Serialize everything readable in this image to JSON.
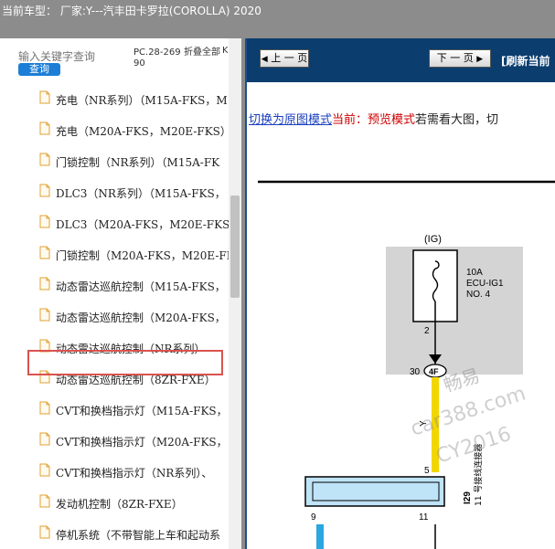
{
  "window": {
    "title": "当前车型：  厂家:Y---汽丰田卡罗拉(COROLLA) 2020"
  },
  "sidebar": {
    "search_placeholder": "输入关键字查询",
    "search_button": "查询",
    "pc_code": "PC.28-26990",
    "collapse_all": "折叠全部",
    "cut_text": "K",
    "items": [
      {
        "label": "充电（NR系列）（M15A-FKS，M"
      },
      {
        "label": "充电（M20A-FKS，M20E-FKS）"
      },
      {
        "label": "门锁控制（NR系列）（M15A-FK"
      },
      {
        "label": "DLC3（NR系列）（M15A-FKS，"
      },
      {
        "label": "DLC3（M20A-FKS，M20E-FKS）"
      },
      {
        "label": "门锁控制（M20A-FKS，M20E-FK"
      },
      {
        "label": "动态雷达巡航控制（M15A-FKS，"
      },
      {
        "label": "动态雷达巡航控制（M20A-FKS，"
      },
      {
        "label": "动态雷达巡航控制（NR系列）"
      },
      {
        "label": "动态雷达巡航控制（8ZR-FXE）"
      },
      {
        "label": "CVT和换档指示灯（M15A-FKS，"
      },
      {
        "label": "CVT和换档指示灯（M20A-FKS，"
      },
      {
        "label": "CVT和换档指示灯（NR系列）、"
      },
      {
        "label": "发动机控制（8ZR-FXE）"
      },
      {
        "label": "停机系统（不带智能上车和起动系"
      }
    ]
  },
  "content": {
    "prev_page": "上 一 页",
    "next_page": "下 一 页",
    "refresh": "[刷新当前",
    "mode": {
      "switch_link": "切换为原图模式",
      "current_label": "当前：预览模式",
      "hint": "若需看大图，切"
    },
    "diagram": {
      "ig_label": "(IG)",
      "fuse_amp": "10A",
      "fuse_name": "ECU-IG1",
      "fuse_no": "NO. 4",
      "pin_2": "2",
      "pin_30": "30",
      "connector_4f": "4F",
      "wire_color_y": "Y",
      "pin_5": "5",
      "connector_id": "I29",
      "connector_name": "11 号接线连接器",
      "pin_9": "9",
      "pin_11": "11",
      "wm1": "畅易",
      "wm2": "car388.com",
      "wm3": "CY2016"
    },
    "colors": {
      "wire_yellow": "#f2d600",
      "wire_blue": "#2aa6e0",
      "connector_fill": "#bfe3f7"
    }
  }
}
